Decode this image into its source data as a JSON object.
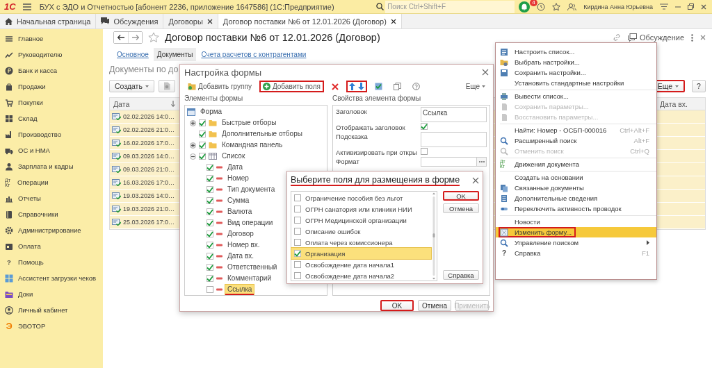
{
  "titlebar": {
    "logo": "1С",
    "title": "БУХ с ЭДО и Отчетностью [абонент 2236, приложение 1647586]  (1С:Предприятие)",
    "search": {
      "placeholder": "Поиск Ctrl+Shift+F"
    },
    "notifications": "4",
    "user": "Кирдина Анна Юрьевна"
  },
  "tabs": [
    {
      "label": "Начальная страница",
      "selected": false,
      "closable": false
    },
    {
      "label": "Обсуждения",
      "selected": false,
      "closable": false
    },
    {
      "label": "Договоры",
      "selected": false,
      "closable": true
    },
    {
      "label": "Договор поставки №6 от 12.01.2026 (Договор)",
      "selected": true,
      "closable": true
    }
  ],
  "sidebar": {
    "items": [
      {
        "label": "Главное"
      },
      {
        "label": "Руководителю"
      },
      {
        "label": "Банк и касса"
      },
      {
        "label": "Продажи"
      },
      {
        "label": "Покупки"
      },
      {
        "label": "Склад"
      },
      {
        "label": "Производство"
      },
      {
        "label": "ОС и НМА"
      },
      {
        "label": "Зарплата и кадры"
      },
      {
        "label": "Операции",
        "glyph": "Дт Кт"
      },
      {
        "label": "Отчеты"
      },
      {
        "label": "Справочники"
      },
      {
        "label": "Администрирование"
      },
      {
        "label": "Оплата"
      },
      {
        "label": "Помощь",
        "glyph": "?"
      },
      {
        "label": "Ассистент загрузки чеков"
      },
      {
        "label": "Доки"
      },
      {
        "label": "Личный кабинет"
      },
      {
        "label": "ЭВОТОР",
        "glyph": "Э"
      }
    ]
  },
  "document": {
    "title": "Договор поставки №6 от 12.01.2026 (Договор)",
    "discussion": "Обсуждение",
    "sections": [
      {
        "label": "Основное",
        "selected": false
      },
      {
        "label": "Документы",
        "selected": true
      },
      {
        "label": "Счета расчетов с контрагентами",
        "selected": false
      }
    ],
    "list_title": "Документы по до",
    "create_button": "Создать",
    "more_button": {
      "label": "Еще",
      "marked": true
    },
    "help_button": "?",
    "table": {
      "columns": [
        "Дата",
        "Дата вх."
      ],
      "rows": [
        {
          "date": "02.02.2026 14:0…"
        },
        {
          "date": "02.02.2026 21:0…"
        },
        {
          "date": "16.02.2026 17:0…"
        },
        {
          "date": "09.03.2026 14:0…"
        },
        {
          "date": "09.03.2026 21:0…"
        },
        {
          "date": "16.03.2026 17:0…"
        },
        {
          "date": "19.03.2026 14:0…"
        },
        {
          "date": "19.03.2026 21:0…"
        },
        {
          "date": "25.03.2026 17:0…"
        }
      ]
    }
  },
  "settings_dialog": {
    "title": "Настройка формы",
    "toolbar": [
      {
        "kind": "add_group",
        "label": "Добавить группу",
        "marked": false
      },
      {
        "kind": "add_fields",
        "label": "Добавить поля",
        "marked": true
      },
      {
        "kind": "delete",
        "marked": false
      },
      {
        "kind": "move",
        "marked": true
      },
      {
        "kind": "check",
        "marked": false
      },
      {
        "kind": "copy",
        "marked": false
      },
      {
        "kind": "help",
        "marked": false
      },
      {
        "kind": "more",
        "label": "Еще",
        "marked": false
      }
    ],
    "elements_label": "Элементы формы",
    "properties_label": "Свойства элемента формы",
    "tree": [
      {
        "label": "Форма",
        "kind": "form",
        "selected": false,
        "children": [
          {
            "label": "Быстрые отборы",
            "kind": "group",
            "checked": true,
            "selected": false,
            "expanded": false
          },
          {
            "label": "Дополнительные отборы",
            "kind": "group",
            "checked": true,
            "selected": false
          },
          {
            "label": "Командная панель",
            "kind": "group",
            "checked": true,
            "selected": false,
            "expanded": false
          },
          {
            "label": "Список",
            "kind": "table",
            "checked": true,
            "selected": false,
            "expanded": true,
            "children": [
              {
                "label": "Дата",
                "kind": "field",
                "checked": true,
                "selected": false,
                "underlined": false
              },
              {
                "label": "Номер",
                "kind": "field",
                "checked": true,
                "selected": false,
                "underlined": false
              },
              {
                "label": "Тип документа",
                "kind": "field",
                "checked": true,
                "selected": false,
                "underlined": false
              },
              {
                "label": "Сумма",
                "kind": "field",
                "checked": true,
                "selected": false,
                "underlined": false
              },
              {
                "label": "Валюта",
                "kind": "field",
                "checked": true,
                "selected": false,
                "underlined": false
              },
              {
                "label": "Вид операции",
                "kind": "field",
                "checked": true,
                "selected": false,
                "underlined": false
              },
              {
                "label": "Договор",
                "kind": "field",
                "checked": true,
                "selected": false,
                "underlined": false
              },
              {
                "label": "Номер вх.",
                "kind": "field",
                "checked": true,
                "selected": false,
                "underlined": false
              },
              {
                "label": "Дата вх.",
                "kind": "field",
                "checked": true,
                "selected": false,
                "underlined": false
              },
              {
                "label": "Ответственный",
                "kind": "field",
                "checked": true,
                "selected": false,
                "underlined": false
              },
              {
                "label": "Комментарий",
                "kind": "field",
                "checked": true,
                "selected": false,
                "underlined": false
              },
              {
                "label": "Ссылка",
                "kind": "field",
                "checked": false,
                "selected": true,
                "underlined": true
              }
            ]
          }
        ]
      }
    ],
    "properties": [
      {
        "label": "Заголовок",
        "kind": "textarea",
        "value": "Ссылка"
      },
      {
        "label": "Отображать заголовок",
        "kind": "checkbox",
        "checked": true
      },
      {
        "label": "Подсказка",
        "kind": "textarea"
      },
      {
        "label": "Активизировать при откры",
        "kind": "checkbox",
        "checked": false
      },
      {
        "label": "Формат",
        "kind": "choice"
      }
    ],
    "buttons": [
      {
        "label": "OK",
        "disabled": false,
        "marked": true
      },
      {
        "label": "Отмена",
        "disabled": false,
        "marked": false
      },
      {
        "label": "Применить",
        "disabled": true,
        "marked": false
      }
    ]
  },
  "select_dialog": {
    "title": "Выберите поля для размещения в форме",
    "underlined": true,
    "items": [
      {
        "label": "Ограничение пособия без льгот",
        "checked": false,
        "selected": false
      },
      {
        "label": "ОГРН санатория или клиники НИИ",
        "checked": false,
        "selected": false
      },
      {
        "label": "ОГРН Медицинской организации",
        "checked": false,
        "selected": false
      },
      {
        "label": "Описание ошибок",
        "checked": false,
        "selected": false
      },
      {
        "label": "Оплата через комиссионера",
        "checked": false,
        "selected": false
      },
      {
        "label": "Организация",
        "checked": true,
        "selected": true
      },
      {
        "label": "Освобождение дата начала1",
        "checked": false,
        "selected": false
      },
      {
        "label": "Освобождение дата начала2",
        "checked": false,
        "selected": false
      }
    ],
    "buttons": [
      {
        "label": "OK",
        "marked": true
      },
      {
        "label": "Отмена",
        "marked": false
      },
      {
        "label": "Справка",
        "marked": false
      }
    ]
  },
  "context_menu": {
    "groups": [
      [
        {
          "label": "Настроить список...",
          "disabled": false,
          "selected": false,
          "marked": false,
          "submenu": false
        },
        {
          "label": "Выбрать настройки...",
          "disabled": false,
          "selected": false,
          "marked": false,
          "submenu": false
        },
        {
          "label": "Сохранить настройки...",
          "disabled": false,
          "selected": false,
          "marked": false,
          "submenu": false
        },
        {
          "label": "Установить стандартные настройки",
          "disabled": false,
          "selected": false,
          "marked": false,
          "submenu": false
        }
      ],
      [
        {
          "label": "Вывести список...",
          "disabled": false,
          "selected": false,
          "marked": false,
          "submenu": false
        },
        {
          "label": "Сохранить параметры...",
          "disabled": true,
          "selected": false,
          "marked": false,
          "submenu": false
        },
        {
          "label": "Восстановить параметры...",
          "disabled": true,
          "selected": false,
          "marked": false,
          "submenu": false
        }
      ],
      [
        {
          "label": "Найти: Номер - ОСБП-000016",
          "shortcut": "Ctrl+Alt+F",
          "disabled": false,
          "selected": false,
          "marked": false,
          "submenu": false
        },
        {
          "label": "Расширенный поиск",
          "shortcut": "Alt+F",
          "disabled": false,
          "selected": false,
          "marked": false,
          "submenu": false
        },
        {
          "label": "Отменить поиск",
          "shortcut": "Ctrl+Q",
          "disabled": true,
          "selected": false,
          "marked": false,
          "submenu": false
        }
      ],
      [
        {
          "label": "Движения документа",
          "glyph": "Дт Кт",
          "disabled": false,
          "selected": false,
          "marked": false,
          "submenu": false
        }
      ],
      [
        {
          "label": "Создать на основании",
          "disabled": false,
          "selected": false,
          "marked": false,
          "submenu": false
        },
        {
          "label": "Связанные документы",
          "disabled": false,
          "selected": false,
          "marked": false,
          "submenu": false
        },
        {
          "label": "Дополнительные сведения",
          "disabled": false,
          "selected": false,
          "marked": false,
          "submenu": false
        },
        {
          "label": "Переключить активность проводок",
          "disabled": false,
          "selected": false,
          "marked": false,
          "submenu": false
        }
      ],
      [
        {
          "label": "Новости",
          "disabled": false,
          "selected": false,
          "marked": false,
          "submenu": false
        },
        {
          "label": "Изменить форму...",
          "disabled": false,
          "selected": true,
          "marked": true,
          "submenu": false
        },
        {
          "label": "Управление поиском",
          "disabled": false,
          "selected": false,
          "marked": false,
          "submenu": true
        },
        {
          "label": "Справка",
          "shortcut": "F1",
          "glyph": "?",
          "disabled": false,
          "selected": false,
          "marked": false,
          "submenu": false
        }
      ]
    ]
  }
}
